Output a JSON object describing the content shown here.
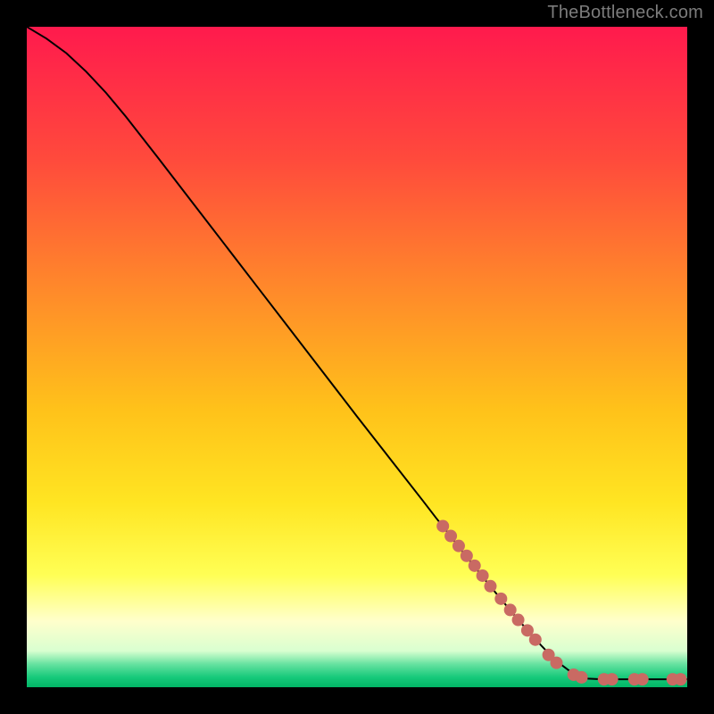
{
  "attribution": "TheBottleneck.com",
  "colors": {
    "frame": "#000000",
    "attribution_text": "#7c7c7c",
    "curve": "#000000",
    "marker_fill": "#c96a63",
    "gradient_stops": [
      {
        "offset": 0.0,
        "color": "#ff1a4d"
      },
      {
        "offset": 0.2,
        "color": "#ff4a3c"
      },
      {
        "offset": 0.4,
        "color": "#ff8a2a"
      },
      {
        "offset": 0.58,
        "color": "#ffc21a"
      },
      {
        "offset": 0.72,
        "color": "#ffe522"
      },
      {
        "offset": 0.83,
        "color": "#ffff55"
      },
      {
        "offset": 0.9,
        "color": "#ffffcc"
      },
      {
        "offset": 0.945,
        "color": "#d9ffd0"
      },
      {
        "offset": 0.965,
        "color": "#66e2a0"
      },
      {
        "offset": 0.985,
        "color": "#16c97a"
      },
      {
        "offset": 1.0,
        "color": "#02b566"
      }
    ]
  },
  "chart_data": {
    "type": "line",
    "title": "",
    "xlabel": "",
    "ylabel": "",
    "xlim": [
      0,
      100
    ],
    "ylim": [
      0,
      100
    ],
    "grid": false,
    "legend": false,
    "series": [
      {
        "name": "bottleneck-curve",
        "x": [
          0,
          3,
          6,
          9,
          12,
          15,
          20,
          25,
          30,
          35,
          40,
          45,
          50,
          55,
          60,
          62,
          64,
          66,
          68,
          70,
          72,
          74,
          76,
          78,
          80,
          82,
          84,
          85,
          87,
          88,
          90,
          92,
          94,
          96,
          98,
          100
        ],
        "y": [
          100,
          98.2,
          96.0,
          93.2,
          90.0,
          86.4,
          80.0,
          73.5,
          67.0,
          60.5,
          54.0,
          47.5,
          41.0,
          34.6,
          28.2,
          25.6,
          23.1,
          20.5,
          18.0,
          15.5,
          13.1,
          10.7,
          8.4,
          6.2,
          4.1,
          2.6,
          1.5,
          1.3,
          1.2,
          1.2,
          1.2,
          1.2,
          1.2,
          1.2,
          1.2,
          1.2
        ]
      }
    ],
    "markers": [
      {
        "name": "dot-1",
        "x": 63.0,
        "y": 24.4
      },
      {
        "name": "dot-2",
        "x": 64.2,
        "y": 22.9
      },
      {
        "name": "dot-3",
        "x": 65.4,
        "y": 21.4
      },
      {
        "name": "dot-4",
        "x": 66.6,
        "y": 19.9
      },
      {
        "name": "dot-5",
        "x": 67.8,
        "y": 18.4
      },
      {
        "name": "dot-6",
        "x": 69.0,
        "y": 16.9
      },
      {
        "name": "dot-7",
        "x": 70.2,
        "y": 15.3
      },
      {
        "name": "dot-8",
        "x": 71.8,
        "y": 13.4
      },
      {
        "name": "dot-9",
        "x": 73.2,
        "y": 11.7
      },
      {
        "name": "dot-10",
        "x": 74.4,
        "y": 10.2
      },
      {
        "name": "dot-11",
        "x": 75.8,
        "y": 8.6
      },
      {
        "name": "dot-12",
        "x": 77.0,
        "y": 7.2
      },
      {
        "name": "dot-13",
        "x": 79.0,
        "y": 4.9
      },
      {
        "name": "dot-14",
        "x": 80.2,
        "y": 3.7
      },
      {
        "name": "dot-15",
        "x": 82.8,
        "y": 1.9
      },
      {
        "name": "dot-16",
        "x": 84.0,
        "y": 1.5
      },
      {
        "name": "dot-17",
        "x": 87.4,
        "y": 1.2
      },
      {
        "name": "dot-18",
        "x": 88.6,
        "y": 1.2
      },
      {
        "name": "dot-19",
        "x": 92.0,
        "y": 1.2
      },
      {
        "name": "dot-20",
        "x": 93.2,
        "y": 1.2
      },
      {
        "name": "dot-21",
        "x": 97.8,
        "y": 1.2
      },
      {
        "name": "dot-22",
        "x": 99.0,
        "y": 1.2
      }
    ]
  }
}
